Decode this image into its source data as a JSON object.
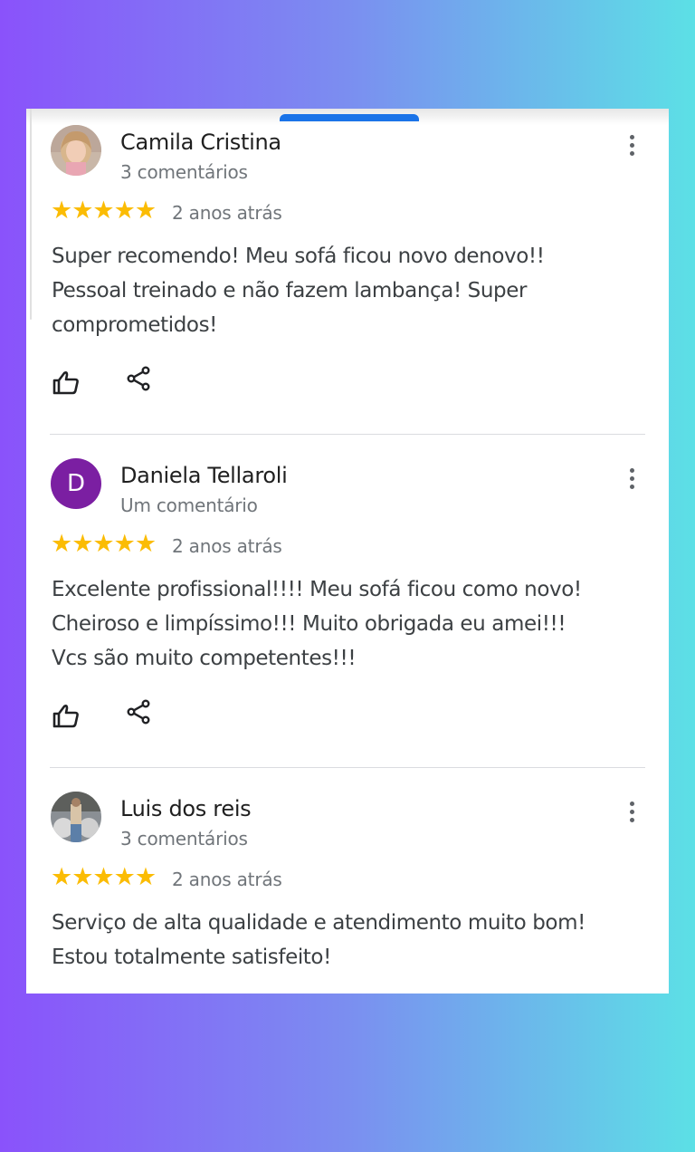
{
  "reviews": [
    {
      "name": "Camila Cristina",
      "subtitle": "3 comentários",
      "rating": 5,
      "stars": "★★★★★",
      "time": "2 anos atrás",
      "lines": [
        "Super recomendo! Meu sofá ficou novo denovo!!",
        "Pessoal treinado e não fazem lambança! Super",
        "comprometidos!"
      ],
      "avatar": "photo"
    },
    {
      "name": "Daniela Tellaroli",
      "subtitle": "Um comentário",
      "rating": 5,
      "stars": "★★★★★",
      "time": "2 anos atrás",
      "lines": [
        "Excelente profissional!!!! Meu sofá ficou como novo!",
        "Cheiroso e limpíssimo!!! Muito obrigada eu amei!!!",
        "Vcs são muito competentes!!!"
      ],
      "avatar_letter": "D",
      "avatar_color": "#7b1fa2"
    },
    {
      "name": "Luis dos reis",
      "subtitle": "3 comentários",
      "rating": 5,
      "stars": "★★★★★",
      "time": "2 anos atrás",
      "lines": [
        "Serviço de alta qualidade e atendimento muito bom!",
        "Estou totalmente satisfeito!"
      ],
      "avatar": "photo"
    }
  ],
  "colors": {
    "star": "#fbbc04",
    "accent": "#1a73e8",
    "text": "#3c4043",
    "muted": "#70757a"
  },
  "icons": [
    "like-icon",
    "share-icon",
    "more-vert-icon"
  ]
}
